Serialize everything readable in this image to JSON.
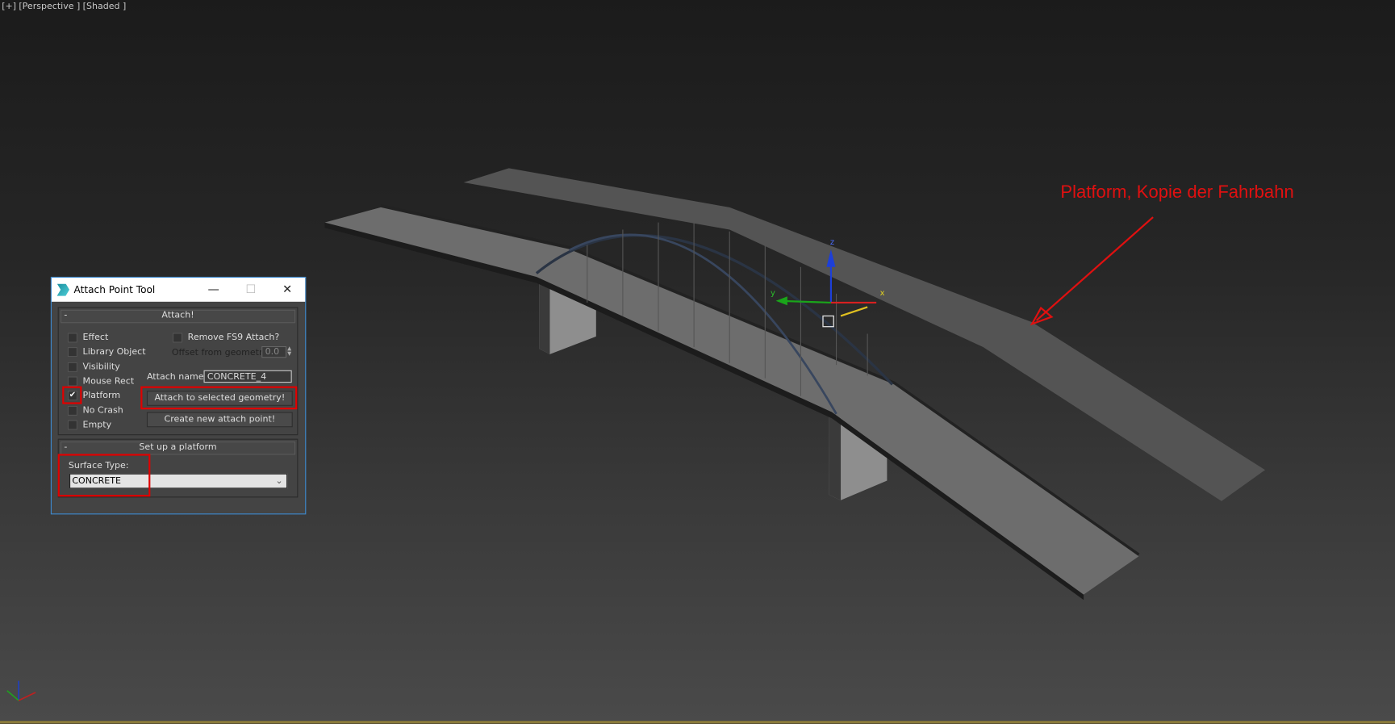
{
  "viewport": {
    "labels": [
      "[+]",
      "[Perspective ]",
      "[Shaded ]"
    ]
  },
  "annotation": {
    "text": "Platform, Kopie der Fahrbahn",
    "color": "#e01010"
  },
  "gizmo": {
    "axes": [
      "x",
      "y",
      "z"
    ]
  },
  "dialog": {
    "title": "Attach Point Tool",
    "minimize": "—",
    "maximize": "☐",
    "close": "✕",
    "attach_rollout": {
      "header": "Attach!",
      "collapse": "-",
      "checkboxes": [
        {
          "label": "Effect",
          "checked": false
        },
        {
          "label": "Library Object",
          "checked": false
        },
        {
          "label": "Visibility",
          "checked": false
        },
        {
          "label": "Mouse Rect",
          "checked": false
        },
        {
          "label": "Platform",
          "checked": true
        },
        {
          "label": "No Crash",
          "checked": false
        },
        {
          "label": "Empty",
          "checked": false
        }
      ],
      "remove_fs9": {
        "label": "Remove FS9 Attach?",
        "checked": false
      },
      "offset_label": "Offset from geometry:",
      "offset_value": "0.0",
      "attach_name_label": "Attach name:",
      "attach_name_value": "CONCRETE_4",
      "attach_button": "Attach to selected geometry!",
      "create_button": "Create new attach point!"
    },
    "platform_rollout": {
      "header": "Set up a platform",
      "collapse": "-",
      "surface_label": "Surface Type:",
      "surface_value": "CONCRETE"
    }
  },
  "colors": {
    "highlight": "#e00000",
    "dialog_border": "#3d8ad0"
  }
}
